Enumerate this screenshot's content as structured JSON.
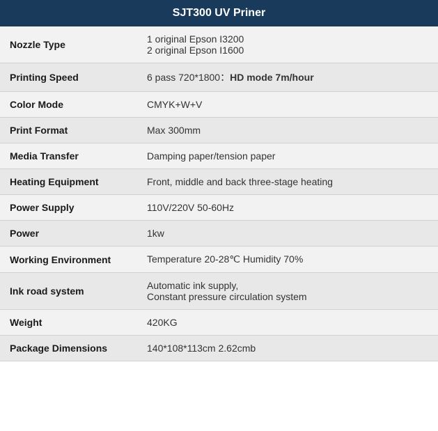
{
  "header": {
    "title": "SJT300 UV Priner"
  },
  "rows": [
    {
      "label": "Nozzle Type",
      "value": "1 original Epson I3200\n2 original Epson I1600",
      "multiline": true,
      "bold_part": null
    },
    {
      "label": "Printing Speed",
      "value": "6 pass 720*1800：",
      "bold_part": "HD mode 7m/hour",
      "multiline": false
    },
    {
      "label": "Color Mode",
      "value": "CMYK+W+V",
      "multiline": false,
      "bold_part": null
    },
    {
      "label": "Print Format",
      "value": "Max 300mm",
      "multiline": false,
      "bold_part": null
    },
    {
      "label": "Media Transfer",
      "value": "Damping paper/tension paper",
      "multiline": false,
      "bold_part": null
    },
    {
      "label": "Heating Equipment",
      "value": "Front, middle and back three-stage heating",
      "multiline": false,
      "bold_part": null
    },
    {
      "label": "Power Supply",
      "value": "110V/220V 50-60Hz",
      "multiline": false,
      "bold_part": null
    },
    {
      "label": "Power",
      "value": "1kw",
      "multiline": false,
      "bold_part": null
    },
    {
      "label": "Working Environment",
      "value": "Temperature 20-28℃ Humidity 70%",
      "multiline": false,
      "bold_part": null
    },
    {
      "label": "Ink road system",
      "value": "Automatic ink supply,\nConstant pressure circulation system",
      "multiline": true,
      "bold_part": null
    },
    {
      "label": "Weight",
      "value": "420KG",
      "multiline": false,
      "bold_part": null
    },
    {
      "label": "Package Dimensions",
      "value": "140*108*113cm 2.62cmb",
      "multiline": false,
      "bold_part": null
    }
  ]
}
